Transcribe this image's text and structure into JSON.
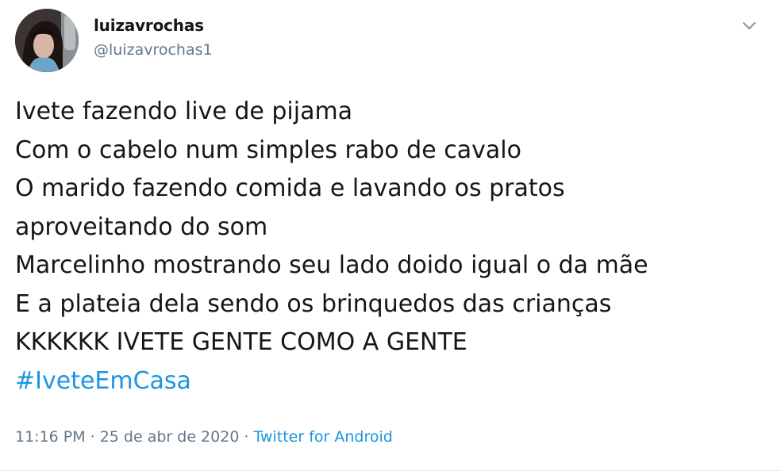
{
  "user": {
    "display_name": "luizavrochas",
    "handle": "@luizavrochas1"
  },
  "tweet": {
    "lines": [
      "Ivete fazendo live de pijama",
      "Com o cabelo num simples rabo de cavalo",
      "O marido fazendo comida e lavando os pratos",
      "aproveitando do som",
      "Marcelinho mostrando seu lado doido igual o da mãe",
      "E a plateia dela sendo os brinquedos das crianças",
      "KKKKKK IVETE GENTE COMO A GENTE"
    ],
    "hashtag": "#IveteEmCasa"
  },
  "meta": {
    "time": "11:16 PM",
    "separator": "·",
    "date": "25 de abr de 2020",
    "source": "Twitter for Android"
  },
  "icons": {
    "avatar": "avatar",
    "menu": "chevron-down-icon"
  },
  "colors": {
    "text": "#14171a",
    "secondary": "#657786",
    "link": "#1b95e0"
  }
}
